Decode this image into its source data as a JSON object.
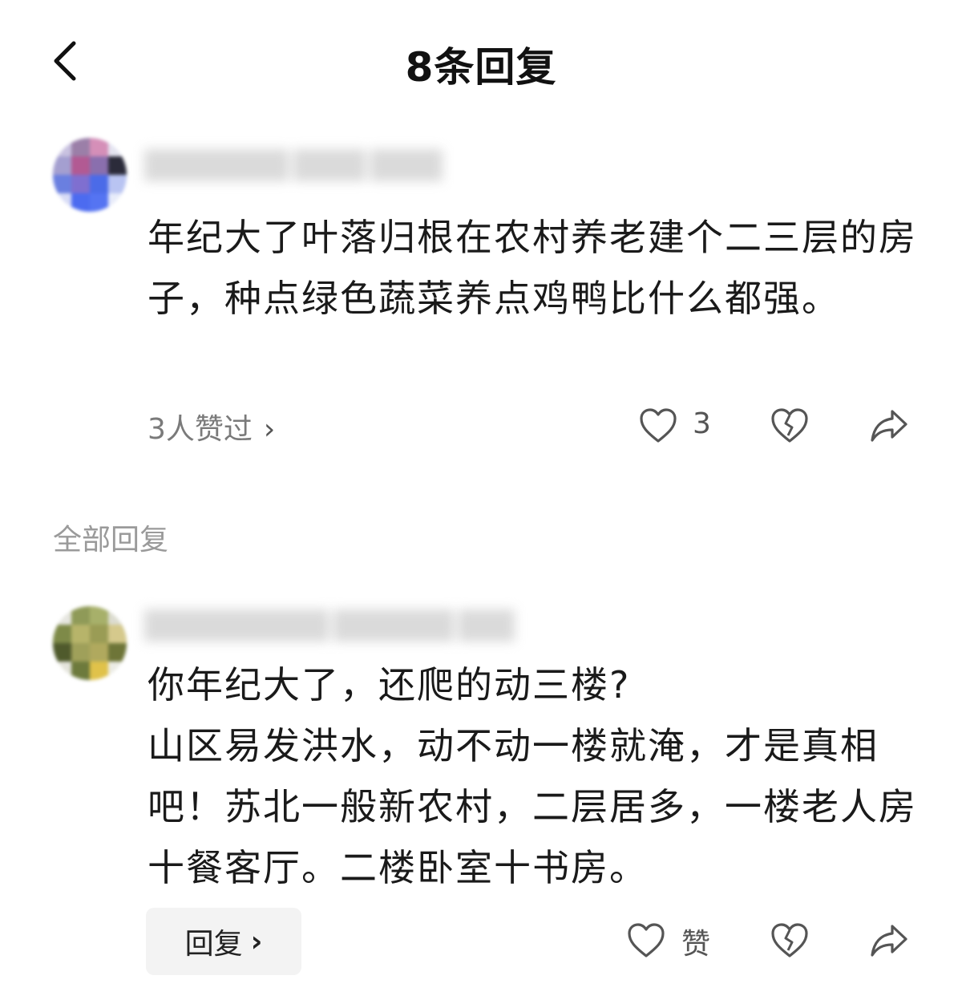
{
  "header": {
    "title": "8条回复",
    "back_icon": "chevron-left-icon"
  },
  "main_comment": {
    "text": "年纪大了叶落归根在农村养老建个二三层的房子，种点绿色蔬菜养点鸡鸭比什么都强。",
    "likers_label": "3人赞过",
    "likers_chevron": "›",
    "like_count": "3",
    "icons": [
      "heart-outline-icon",
      "broken-heart-icon",
      "share-arrow-icon"
    ]
  },
  "section": {
    "label": "全部回复"
  },
  "reply": {
    "text": "你年纪大了，还爬的动三楼?\n山区易发洪水，动不动一楼就淹，才是真相吧！苏北一般新农村，二层居多，一楼老人房十餐客厅。二楼卧室十书房。",
    "reply_button": "回复",
    "reply_chevron": "›",
    "like_label": "赞",
    "icons": [
      "heart-outline-icon",
      "broken-heart-icon",
      "share-arrow-icon"
    ]
  },
  "colors": {
    "text_primary": "#1a1a1a",
    "text_secondary": "#7a7a7a",
    "section_label": "#9a9a9a",
    "icon": "#555555",
    "reply_button_bg": "#f3f3f3"
  }
}
